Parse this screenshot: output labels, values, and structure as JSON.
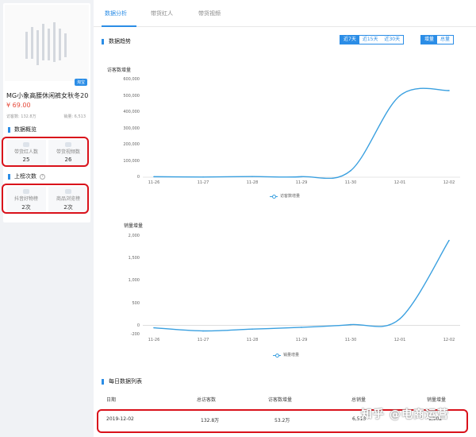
{
  "product": {
    "platform_badge": "淘宝",
    "title": "MG小象高腰休闲裤女秋冬20...",
    "price": "¥ 69.00",
    "visitors_label": "访客数: 132.8万",
    "sales_label": "销量: 6,513"
  },
  "overview": {
    "title": "数据概览",
    "stats": [
      {
        "label": "带货红人数",
        "value": "25"
      },
      {
        "label": "带货视频数",
        "value": "26"
      }
    ]
  },
  "ranking": {
    "title": "上榜次数",
    "help_icon": "?",
    "stats": [
      {
        "label": "抖音好物榜",
        "value": "2次"
      },
      {
        "label": "商品浏览榜",
        "value": "2次"
      }
    ]
  },
  "tabs": [
    "数据分析",
    "带货红人",
    "带货视频"
  ],
  "trend": {
    "title": "数据趋势",
    "ranges": [
      "近7天",
      "近15天",
      "近30天"
    ],
    "modes": [
      "增量",
      "总量"
    ]
  },
  "colors": {
    "accent": "#2b8de6",
    "line": "#3aa0e0",
    "highlight": "#d9121b"
  },
  "chart_data": [
    {
      "type": "line",
      "title": "访客数增量",
      "categories": [
        "11-26",
        "11-27",
        "11-28",
        "11-29",
        "11-30",
        "12-01",
        "12-02"
      ],
      "series": [
        {
          "name": "访客数增量",
          "values": [
            3000,
            1000,
            4000,
            3000,
            40000,
            500000,
            532000
          ]
        }
      ],
      "ylim": [
        0,
        600000
      ],
      "yticks": [
        "600,000",
        "500,000",
        "400,000",
        "300,000",
        "200,000",
        "100,000",
        "0"
      ],
      "legend": "bottom-center",
      "grid": false
    },
    {
      "type": "line",
      "title": "销量增量",
      "categories": [
        "11-26",
        "11-27",
        "11-28",
        "11-29",
        "11-30",
        "12-01",
        "12-02"
      ],
      "series": [
        {
          "name": "销量增量",
          "values": [
            -50,
            -120,
            -80,
            -40,
            20,
            150,
            1900
          ]
        }
      ],
      "ylim": [
        -200,
        2000
      ],
      "yticks": [
        "2,000",
        "1,500",
        "1,000",
        "500",
        "0",
        "-200"
      ],
      "legend": "bottom-center",
      "grid": false
    }
  ],
  "daily_table": {
    "title": "每日数据列表",
    "columns": [
      "日期",
      "总访客数",
      "访客数增量",
      "总销量",
      "销量增量"
    ],
    "rows": [
      [
        "2019-12-02",
        "132.8万",
        "53.2万",
        "6,513",
        "1,902"
      ]
    ]
  },
  "watermark": "知乎 @电商运营"
}
